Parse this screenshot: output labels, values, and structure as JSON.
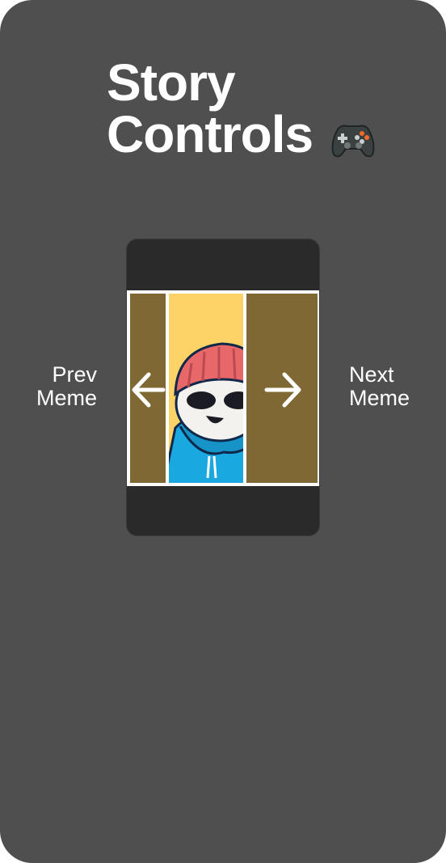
{
  "title": {
    "line1": "Story",
    "line2": "Controls",
    "icon": "gamepad-icon"
  },
  "controls": {
    "prev": {
      "line1": "Prev",
      "line2": "Meme",
      "icon": "arrow-left-icon"
    },
    "next": {
      "line1": "Next",
      "line2": "Meme",
      "icon": "arrow-right-icon"
    }
  },
  "colors": {
    "background": "#4f4f4f",
    "phone": "#2a2a2a",
    "meme_bg": "#fdd267",
    "overlay": "#806834",
    "hat": "#e8686a",
    "hoodie": "#1aa8e0"
  }
}
